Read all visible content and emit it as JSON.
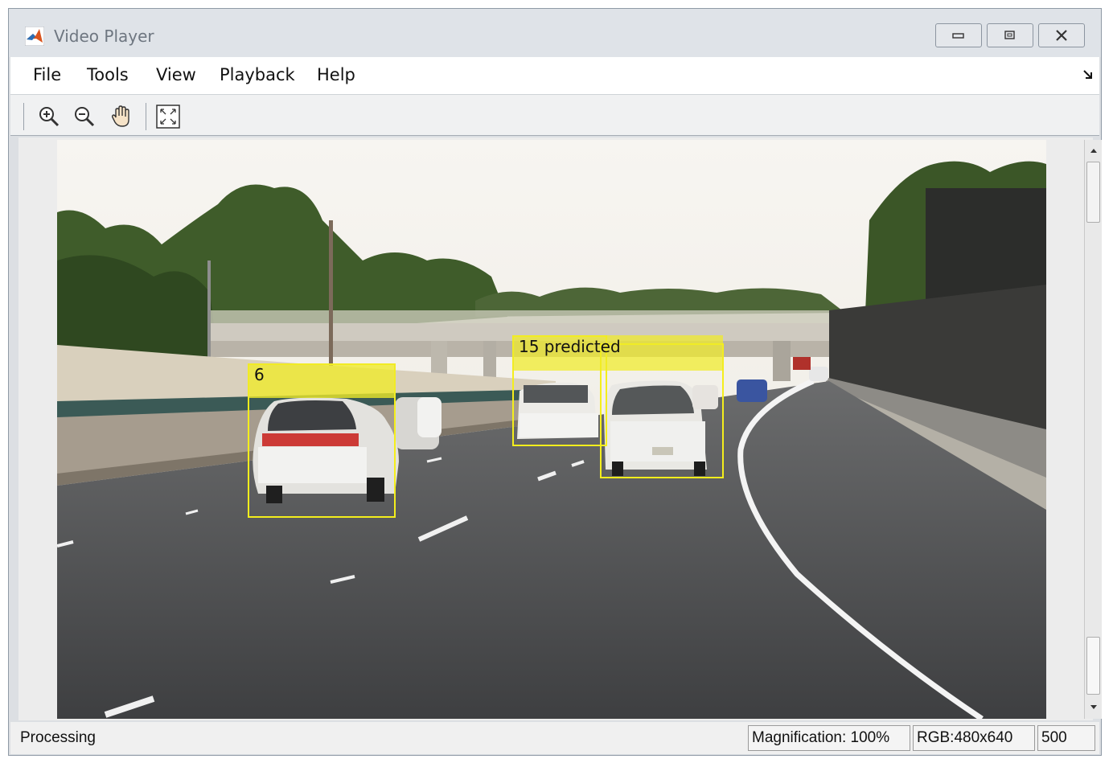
{
  "window": {
    "title": "Video Player"
  },
  "menu": {
    "items": [
      "File",
      "Tools",
      "View",
      "Playback",
      "Help"
    ]
  },
  "toolbar": {
    "buttons": [
      {
        "name": "zoom-in-icon"
      },
      {
        "name": "zoom-out-icon"
      },
      {
        "name": "pan-hand-icon"
      },
      {
        "name": "fit-to-window-icon"
      }
    ]
  },
  "video": {
    "detections": [
      {
        "label": "6"
      },
      {
        "label": "15 predicted"
      }
    ]
  },
  "status": {
    "text": "Processing",
    "magnification": "Magnification: 100%",
    "format": "RGB:480x640",
    "frame": "500"
  },
  "colors": {
    "bbox": "#f4ee1c",
    "bbox_label_bg": "#f0eb28"
  }
}
